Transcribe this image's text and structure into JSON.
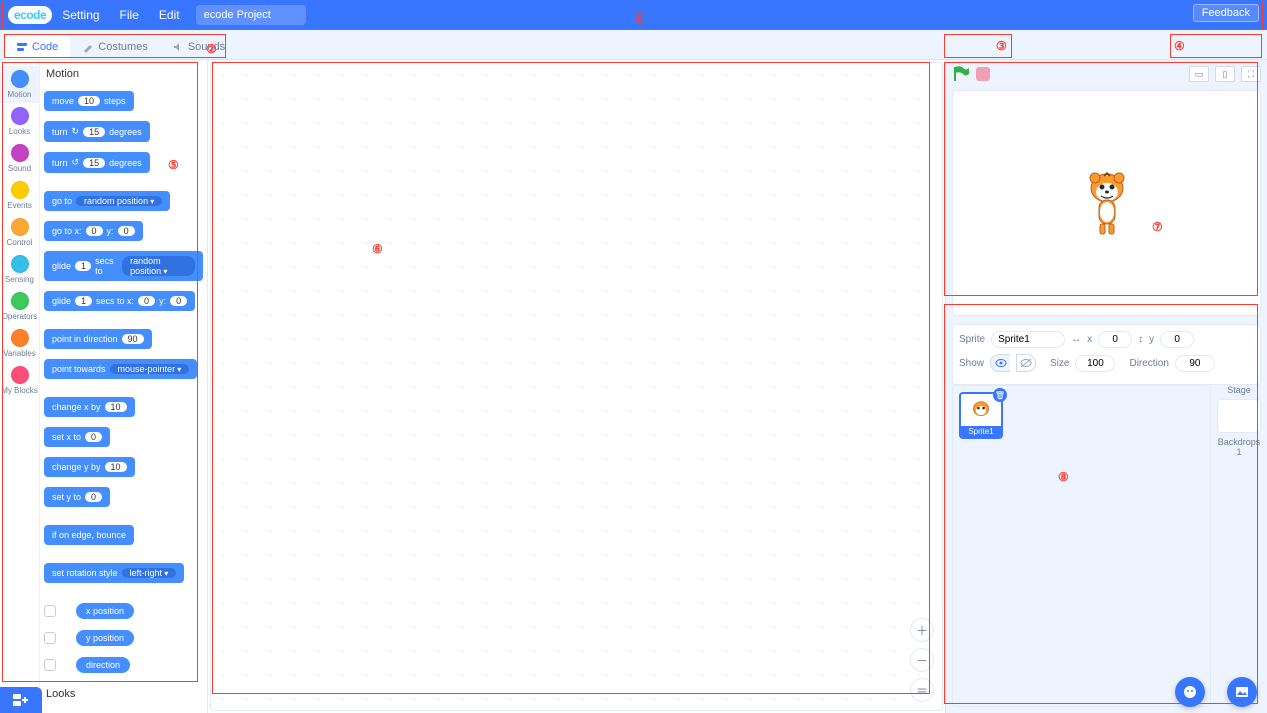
{
  "menu": {
    "logo": "ecode",
    "setting": "Setting",
    "file": "File",
    "edit": "Edit",
    "project_name": "ecode Project",
    "feedback": "Feedback"
  },
  "tabs": {
    "code": "Code",
    "costumes": "Costumes",
    "sounds": "Sounds"
  },
  "categories": [
    {
      "name": "Motion",
      "color": "#448eff"
    },
    {
      "name": "Looks",
      "color": "#9263ff"
    },
    {
      "name": "Sound",
      "color": "#c542c2"
    },
    {
      "name": "Events",
      "color": "#ffcc00"
    },
    {
      "name": "Control",
      "color": "#ffa733"
    },
    {
      "name": "Sensing",
      "color": "#33bfe8"
    },
    {
      "name": "Operators",
      "color": "#3dc95c"
    },
    {
      "name": "Variables",
      "color": "#ff7f2a"
    },
    {
      "name": "My Blocks",
      "color": "#ff4f78"
    }
  ],
  "blocks": {
    "title": "Motion",
    "move": {
      "pre": "move",
      "val": "10",
      "post": "steps"
    },
    "turn_cw": {
      "pre": "turn",
      "val": "15",
      "post": "degrees"
    },
    "turn_ccw": {
      "pre": "turn",
      "val": "15",
      "post": "degrees"
    },
    "goto_rand": {
      "pre": "go to",
      "opt": "random position"
    },
    "goto_xy": {
      "pre": "go to x:",
      "x": "0",
      "mid": "y:",
      "y": "0"
    },
    "glide_rand": {
      "pre": "glide",
      "secs": "1",
      "mid": "secs to",
      "opt": "random position"
    },
    "glide_xy": {
      "pre": "glide",
      "secs": "1",
      "mid": "secs to x:",
      "x": "0",
      "mid2": "y:",
      "y": "0"
    },
    "point_dir": {
      "pre": "point in direction",
      "val": "90"
    },
    "point_towards": {
      "pre": "point towards",
      "opt": "mouse-pointer"
    },
    "change_x": {
      "pre": "change x by",
      "val": "10"
    },
    "set_x": {
      "pre": "set x to",
      "val": "0"
    },
    "change_y": {
      "pre": "change y by",
      "val": "10"
    },
    "set_y": {
      "pre": "set y to",
      "val": "0"
    },
    "edge_bounce": "if on edge, bounce",
    "rotation_style": {
      "pre": "set rotation style",
      "opt": "left-right"
    },
    "rep_x": "x position",
    "rep_y": "y position",
    "rep_dir": "direction",
    "next_title": "Looks"
  },
  "sprite_info": {
    "label_sprite": "Sprite",
    "name": "Sprite1",
    "label_x": "x",
    "x": "0",
    "label_y": "y",
    "y": "0",
    "label_show": "Show",
    "label_size": "Size",
    "size": "100",
    "label_dir": "Direction",
    "dir": "90"
  },
  "stage_panel": {
    "label_stage": "Stage",
    "label_backdrops": "Backdrops",
    "backdrop_count": "1"
  },
  "sprite_tile": {
    "name": "Sprite1"
  },
  "annotations": {
    "1": "①",
    "2": "②",
    "3": "③",
    "4": "④",
    "5": "⑤",
    "6": "⑥",
    "7": "⑦",
    "8": "⑧"
  }
}
